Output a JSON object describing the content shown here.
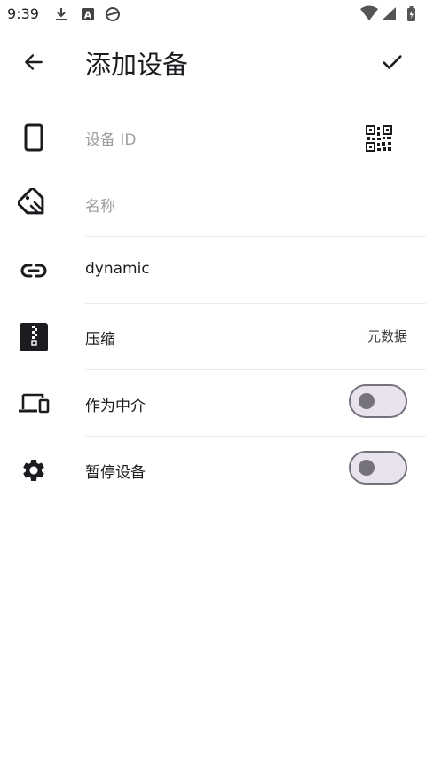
{
  "status_bar": {
    "time": "9:39",
    "icons": [
      "download-icon",
      "a-box-icon",
      "sync-globe-icon"
    ],
    "right_icons": [
      "wifi-icon",
      "signal-icon",
      "battery-charging-icon"
    ]
  },
  "app_bar": {
    "back_icon": "arrow-back-icon",
    "title": "添加设备",
    "confirm_icon": "check-icon"
  },
  "rows": [
    {
      "icon": "phone-icon",
      "placeholder": "设备 ID",
      "trailing_icon": "qr-code-icon"
    },
    {
      "icon": "tag-icon",
      "placeholder": "名称"
    },
    {
      "icon": "link-icon",
      "value": "dynamic"
    },
    {
      "icon": "zip-archive-icon",
      "label": "压缩",
      "trailing": "元数据"
    },
    {
      "icon": "devices-icon",
      "label": "作为中介",
      "toggle": false
    },
    {
      "icon": "gear-icon",
      "label": "暂停设备",
      "toggle": false
    }
  ],
  "colors": {
    "background": "#ffffff",
    "hint": "#9e9e9e",
    "switch_track": "#e8e3ec",
    "switch_outline": "#76727d"
  }
}
